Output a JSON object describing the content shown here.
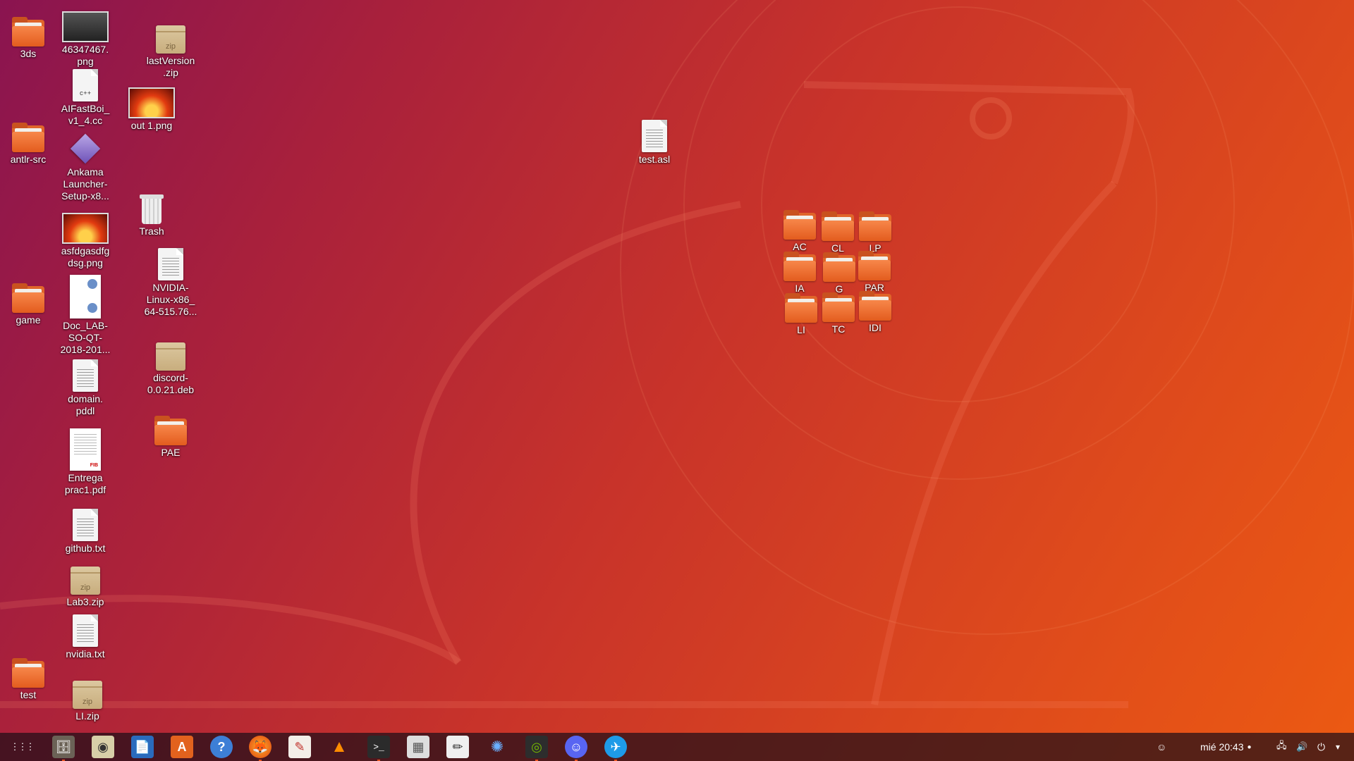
{
  "desktop": {
    "icons": [
      {
        "id": "3ds",
        "label": "3ds",
        "type": "folder"
      },
      {
        "id": "png46347467",
        "label": "46347467.\npng",
        "type": "image"
      },
      {
        "id": "lastversion",
        "label": "lastVersion\n.zip",
        "type": "zip"
      },
      {
        "id": "aifastboi",
        "label": "AIFastBoi_\nv1_4.cc",
        "type": "source"
      },
      {
        "id": "out1",
        "label": "out 1.png",
        "type": "image"
      },
      {
        "id": "antlr",
        "label": "antlr-src",
        "type": "folder"
      },
      {
        "id": "ankama",
        "label": "Ankama\nLauncher-\nSetup-x8...",
        "type": "appimage"
      },
      {
        "id": "trash",
        "label": "Trash",
        "type": "trash"
      },
      {
        "id": "asfdg",
        "label": "asfdgasdfg\ndsg.png",
        "type": "image"
      },
      {
        "id": "nvidia_run",
        "label": "NVIDIA-\nLinux-x86_\n64-515.76...",
        "type": "text"
      },
      {
        "id": "game",
        "label": "game",
        "type": "folder"
      },
      {
        "id": "doclab",
        "label": "Doc_LAB-\nSO-QT-\n2018-201...",
        "type": "document"
      },
      {
        "id": "discord_deb",
        "label": "discord-\n0.0.21.deb",
        "type": "package"
      },
      {
        "id": "domain",
        "label": "domain.\npddl",
        "type": "text"
      },
      {
        "id": "pae",
        "label": "PAE",
        "type": "folder"
      },
      {
        "id": "entrega",
        "label": "Entrega\nprac1.pdf",
        "type": "pdf"
      },
      {
        "id": "github",
        "label": "github.txt",
        "type": "text"
      },
      {
        "id": "lab3",
        "label": "Lab3.zip",
        "type": "zip"
      },
      {
        "id": "nvidia_txt",
        "label": "nvidia.txt",
        "type": "text"
      },
      {
        "id": "test",
        "label": "test",
        "type": "folder"
      },
      {
        "id": "li_zip",
        "label": "LI.zip",
        "type": "zip"
      },
      {
        "id": "test_asl",
        "label": "test.asl",
        "type": "text"
      },
      {
        "id": "ac",
        "label": "AC",
        "type": "folder"
      },
      {
        "id": "cl",
        "label": "CL",
        "type": "folder"
      },
      {
        "id": "lp",
        "label": "LP",
        "type": "folder"
      },
      {
        "id": "ia",
        "label": "IA",
        "type": "folder"
      },
      {
        "id": "g",
        "label": "G",
        "type": "folder"
      },
      {
        "id": "par",
        "label": "PAR",
        "type": "folder"
      },
      {
        "id": "li",
        "label": "LI",
        "type": "folder"
      },
      {
        "id": "tc",
        "label": "TC",
        "type": "folder"
      },
      {
        "id": "idi",
        "label": "IDI",
        "type": "folder"
      }
    ],
    "file_tags": {
      "zip": "zip",
      "cpp": "c++"
    }
  },
  "taskbar": {
    "apps": [
      {
        "name": "show-applications-icon",
        "glyph": "⋮⋮⋮"
      },
      {
        "name": "files-icon",
        "glyph": "🗄"
      },
      {
        "name": "rhythmbox-icon",
        "glyph": "◉"
      },
      {
        "name": "writer-icon",
        "glyph": "📄"
      },
      {
        "name": "software-center-icon",
        "glyph": "A"
      },
      {
        "name": "help-icon",
        "glyph": "?"
      },
      {
        "name": "firefox-icon",
        "glyph": "🦊"
      },
      {
        "name": "document-viewer-icon",
        "glyph": "✎"
      },
      {
        "name": "vlc-icon",
        "glyph": "▲"
      },
      {
        "name": "terminal-icon",
        "glyph": ">_"
      },
      {
        "name": "calculator-icon",
        "glyph": "▦"
      },
      {
        "name": "text-editor-icon",
        "glyph": "✏"
      },
      {
        "name": "shotwell-icon",
        "glyph": "✺"
      },
      {
        "name": "nvidia-settings-icon",
        "glyph": "◎"
      },
      {
        "name": "discord-icon",
        "glyph": "☺"
      },
      {
        "name": "app-blue-icon",
        "glyph": "✈"
      }
    ],
    "clock": "mié 20:43",
    "tray_discord": "☺",
    "tray_network": "🖧",
    "tray_volume": "🔊",
    "tray_power": "⏻",
    "tray_menu": "▾"
  },
  "colors": {
    "accent": "#e95420"
  }
}
